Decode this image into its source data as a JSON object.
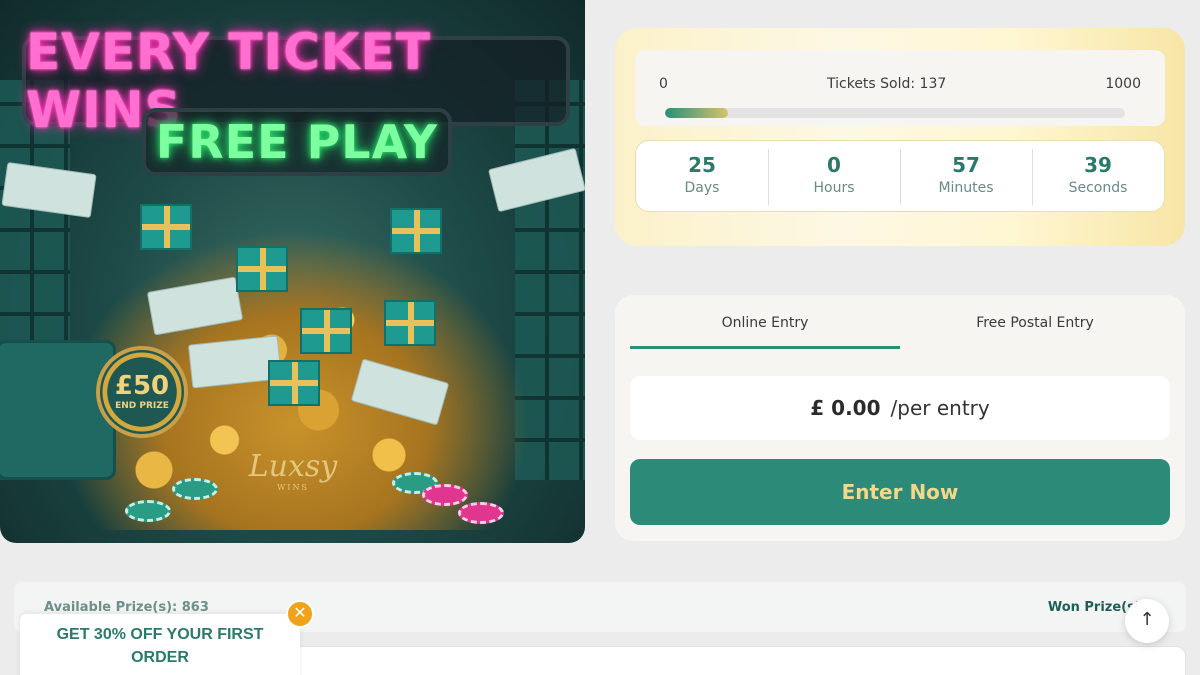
{
  "hero": {
    "headline": "EVERY TICKET WINS",
    "subheadline": "FREE PLAY",
    "badge_amount": "£50",
    "badge_label": "END PRIZE",
    "logo_text": "Luxsy",
    "logo_sub": "WINS"
  },
  "progress": {
    "min": "0",
    "max": "1000",
    "label": "Tickets Sold: 137",
    "sold": 137,
    "total": 1000
  },
  "countdown": [
    {
      "value": "25",
      "label": "Days"
    },
    {
      "value": "0",
      "label": "Hours"
    },
    {
      "value": "57",
      "label": "Minutes"
    },
    {
      "value": "39",
      "label": "Seconds"
    }
  ],
  "entry": {
    "tabs": [
      "Online Entry",
      "Free Postal Entry"
    ],
    "active_tab": "Online Entry",
    "price": "£ 0.00",
    "per": "/per entry",
    "button": "Enter Now"
  },
  "prizes": {
    "available": "Available Prize(s): 863",
    "won": "Won Prize(s): "
  },
  "promo": {
    "line1": "GET 30% OFF YOUR FIRST",
    "line2": "ORDER",
    "close_icon": "close-icon"
  },
  "scroll_top": {
    "icon": "arrow-up-icon",
    "glyph": "↑"
  },
  "colors": {
    "accent": "#2b8a78",
    "gold": "#f3d88b",
    "promo_close": "#f0a21a"
  }
}
